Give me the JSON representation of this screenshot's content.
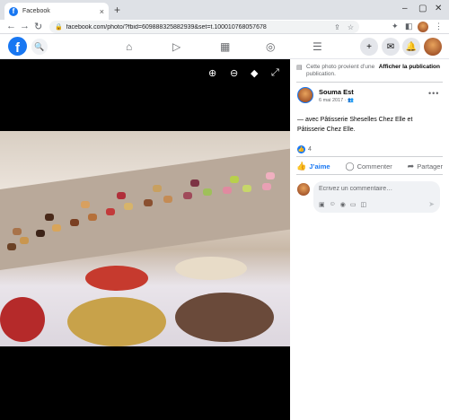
{
  "browser": {
    "tab_title": "Facebook",
    "tab_favicon": "f",
    "url": "facebook.com/photo/?fbid=609888325882939&set=t.100010768057678"
  },
  "facebook": {
    "logo": "f"
  },
  "panel": {
    "notice_text": "Cette photo provient d’une publication.",
    "notice_link": "Afficher la publication",
    "author": "Souma Est",
    "date": "6 mai 2017 · ",
    "caption": "— avec Pâtisserie Sheselles Chez Elle et Pâtisserie Chez Elle.",
    "reaction_count": "4",
    "actions": {
      "like": "J’aime",
      "comment": "Commenter",
      "share": "Partager"
    },
    "comment_placeholder": "Écrivez un commentaire…"
  },
  "colors": {
    "facebook_blue": "#1877f2",
    "viewer_background": "#000000"
  }
}
